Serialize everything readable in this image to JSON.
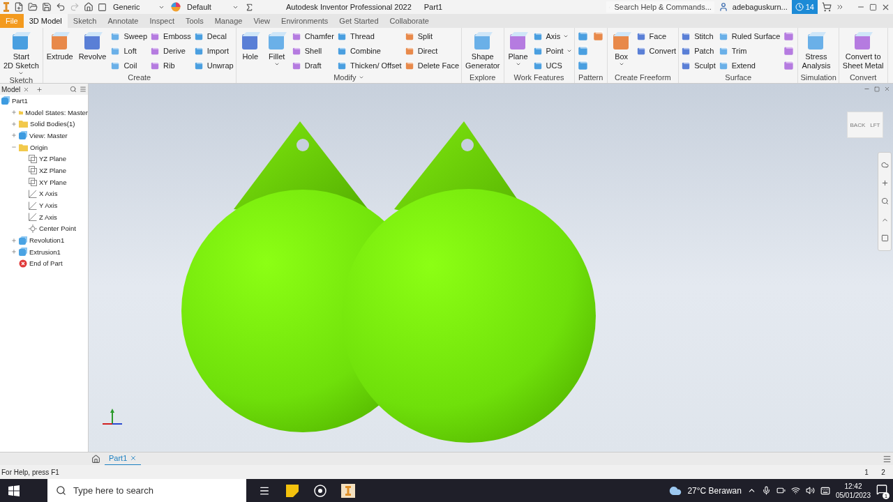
{
  "quick_access": {
    "appearance": "Generic",
    "style": "Default"
  },
  "title": {
    "app": "Autodesk Inventor Professional 2022",
    "document": "Part1"
  },
  "search": {
    "placeholder": "Search Help & Commands..."
  },
  "user": {
    "name": "adebaguskurn..."
  },
  "notifications": {
    "count": "14"
  },
  "tabs": [
    {
      "label": "File",
      "kind": "file",
      "selected": false
    },
    {
      "label": "3D Model",
      "kind": "tab",
      "selected": true
    },
    {
      "label": "Sketch",
      "kind": "tab",
      "selected": false
    },
    {
      "label": "Annotate",
      "kind": "tab",
      "selected": false
    },
    {
      "label": "Inspect",
      "kind": "tab",
      "selected": false
    },
    {
      "label": "Tools",
      "kind": "tab",
      "selected": false
    },
    {
      "label": "Manage",
      "kind": "tab",
      "selected": false
    },
    {
      "label": "View",
      "kind": "tab",
      "selected": false
    },
    {
      "label": "Environments",
      "kind": "tab",
      "selected": false
    },
    {
      "label": "Get Started",
      "kind": "tab",
      "selected": false
    },
    {
      "label": "Collaborate",
      "kind": "tab",
      "selected": false
    }
  ],
  "ribbon_panels": [
    {
      "title": "Sketch",
      "has_menu": false,
      "groups": [
        {
          "kind": "large",
          "label": "Start\n2D Sketch",
          "dropdown": true
        }
      ]
    },
    {
      "title": "Create",
      "has_menu": false,
      "groups": [
        {
          "kind": "large",
          "label": "Extrude",
          "dropdown": false
        },
        {
          "kind": "large",
          "label": "Revolve",
          "dropdown": false
        },
        {
          "kind": "stack",
          "items": [
            {
              "label": "Sweep",
              "dropdown": false
            },
            {
              "label": "Loft",
              "dropdown": false
            },
            {
              "label": "Coil",
              "dropdown": false
            }
          ]
        },
        {
          "kind": "stack",
          "items": [
            {
              "label": "Emboss",
              "dropdown": false
            },
            {
              "label": "Derive",
              "dropdown": false
            },
            {
              "label": "Rib",
              "dropdown": false
            }
          ]
        },
        {
          "kind": "stack",
          "items": [
            {
              "label": "Decal",
              "dropdown": false
            },
            {
              "label": "Import",
              "dropdown": false
            },
            {
              "label": "Unwrap",
              "dropdown": false
            }
          ]
        }
      ]
    },
    {
      "title": "Modify",
      "has_menu": true,
      "groups": [
        {
          "kind": "large",
          "label": "Hole",
          "dropdown": false
        },
        {
          "kind": "large",
          "label": "Fillet",
          "dropdown": true
        },
        {
          "kind": "stack",
          "items": [
            {
              "label": "Chamfer",
              "dropdown": false
            },
            {
              "label": "Shell",
              "dropdown": false
            },
            {
              "label": "Draft",
              "dropdown": false
            }
          ]
        },
        {
          "kind": "stack",
          "items": [
            {
              "label": "Thread",
              "dropdown": false
            },
            {
              "label": "Combine",
              "dropdown": false
            },
            {
              "label": "Thicken/ Offset",
              "dropdown": false
            }
          ]
        },
        {
          "kind": "stack",
          "items": [
            {
              "label": "Split",
              "dropdown": false
            },
            {
              "label": "Direct",
              "dropdown": false
            },
            {
              "label": "Delete Face",
              "dropdown": false
            }
          ]
        }
      ]
    },
    {
      "title": "Explore",
      "has_menu": false,
      "groups": [
        {
          "kind": "large",
          "label": "Shape\nGenerator",
          "dropdown": false
        }
      ]
    },
    {
      "title": "Work Features",
      "has_menu": false,
      "groups": [
        {
          "kind": "large",
          "label": "Plane",
          "dropdown": true
        },
        {
          "kind": "stack",
          "items": [
            {
              "label": "Axis",
              "dropdown": true
            },
            {
              "label": "Point",
              "dropdown": true
            },
            {
              "label": "UCS",
              "dropdown": false
            }
          ]
        }
      ]
    },
    {
      "title": "Pattern",
      "has_menu": false,
      "groups": [
        {
          "kind": "stack",
          "items": [
            {
              "kind": "icon"
            },
            {
              "kind": "icon"
            },
            {
              "kind": "icon"
            }
          ]
        },
        {
          "kind": "stack",
          "items": [
            {
              "kind": "icon"
            }
          ]
        }
      ]
    },
    {
      "title": "Create Freeform",
      "has_menu": false,
      "groups": [
        {
          "kind": "large",
          "label": "Box",
          "dropdown": true
        },
        {
          "kind": "stack",
          "items": [
            {
              "label": "Face",
              "dropdown": false
            },
            {
              "label": "Convert",
              "dropdown": false
            }
          ]
        }
      ]
    },
    {
      "title": "Surface",
      "has_menu": false,
      "groups": [
        {
          "kind": "stack",
          "items": [
            {
              "label": "Stitch",
              "dropdown": false
            },
            {
              "label": "Patch",
              "dropdown": false
            },
            {
              "label": "Sculpt",
              "dropdown": false
            }
          ]
        },
        {
          "kind": "stack",
          "items": [
            {
              "label": "Ruled Surface",
              "dropdown": false
            },
            {
              "label": "Trim",
              "dropdown": false
            },
            {
              "label": "Extend",
              "dropdown": false
            }
          ]
        },
        {
          "kind": "stack",
          "items": [
            {
              "kind": "icon"
            },
            {
              "kind": "icon"
            },
            {
              "kind": "icon"
            }
          ]
        }
      ]
    },
    {
      "title": "Simulation",
      "has_menu": false,
      "groups": [
        {
          "kind": "large",
          "label": "Stress\nAnalysis",
          "dropdown": false
        }
      ]
    },
    {
      "title": "Convert",
      "has_menu": false,
      "groups": [
        {
          "kind": "large",
          "label": "Convert to\nSheet Metal",
          "dropdown": false
        }
      ]
    }
  ],
  "browser": {
    "title": "Model",
    "tree": [
      {
        "label": "Part1",
        "kind": "part",
        "children": [
          {
            "label": "Model States: Master",
            "kind": "folder",
            "expanded": false
          },
          {
            "label": "Solid Bodies(1)",
            "kind": "folder",
            "expanded": false
          },
          {
            "label": "View: Master",
            "kind": "view",
            "expanded": false
          },
          {
            "label": "Origin",
            "kind": "folder",
            "expanded": true,
            "children": [
              {
                "label": "YZ Plane",
                "kind": "plane"
              },
              {
                "label": "XZ Plane",
                "kind": "plane"
              },
              {
                "label": "XY Plane",
                "kind": "plane"
              },
              {
                "label": "X Axis",
                "kind": "axis"
              },
              {
                "label": "Y Axis",
                "kind": "axis"
              },
              {
                "label": "Z Axis",
                "kind": "axis"
              },
              {
                "label": "Center Point",
                "kind": "point"
              }
            ]
          },
          {
            "label": "Revolution1",
            "kind": "revolve",
            "expanded": false
          },
          {
            "label": "Extrusion1",
            "kind": "extrude",
            "expanded": false
          },
          {
            "label": "End of Part",
            "kind": "end"
          }
        ]
      }
    ]
  },
  "view_cube": {
    "faces": [
      "BACK",
      "LFT"
    ]
  },
  "document_tabs": [
    {
      "label": "Part1",
      "selected": true
    }
  ],
  "status_bar": {
    "help": "For Help, press F1",
    "counters": [
      "1",
      "2"
    ]
  },
  "taskbar": {
    "search_placeholder": "Type here to search",
    "weather": "27°C Berawan",
    "time": "12:42",
    "date": "05/01/2023",
    "notification_count": "1"
  }
}
